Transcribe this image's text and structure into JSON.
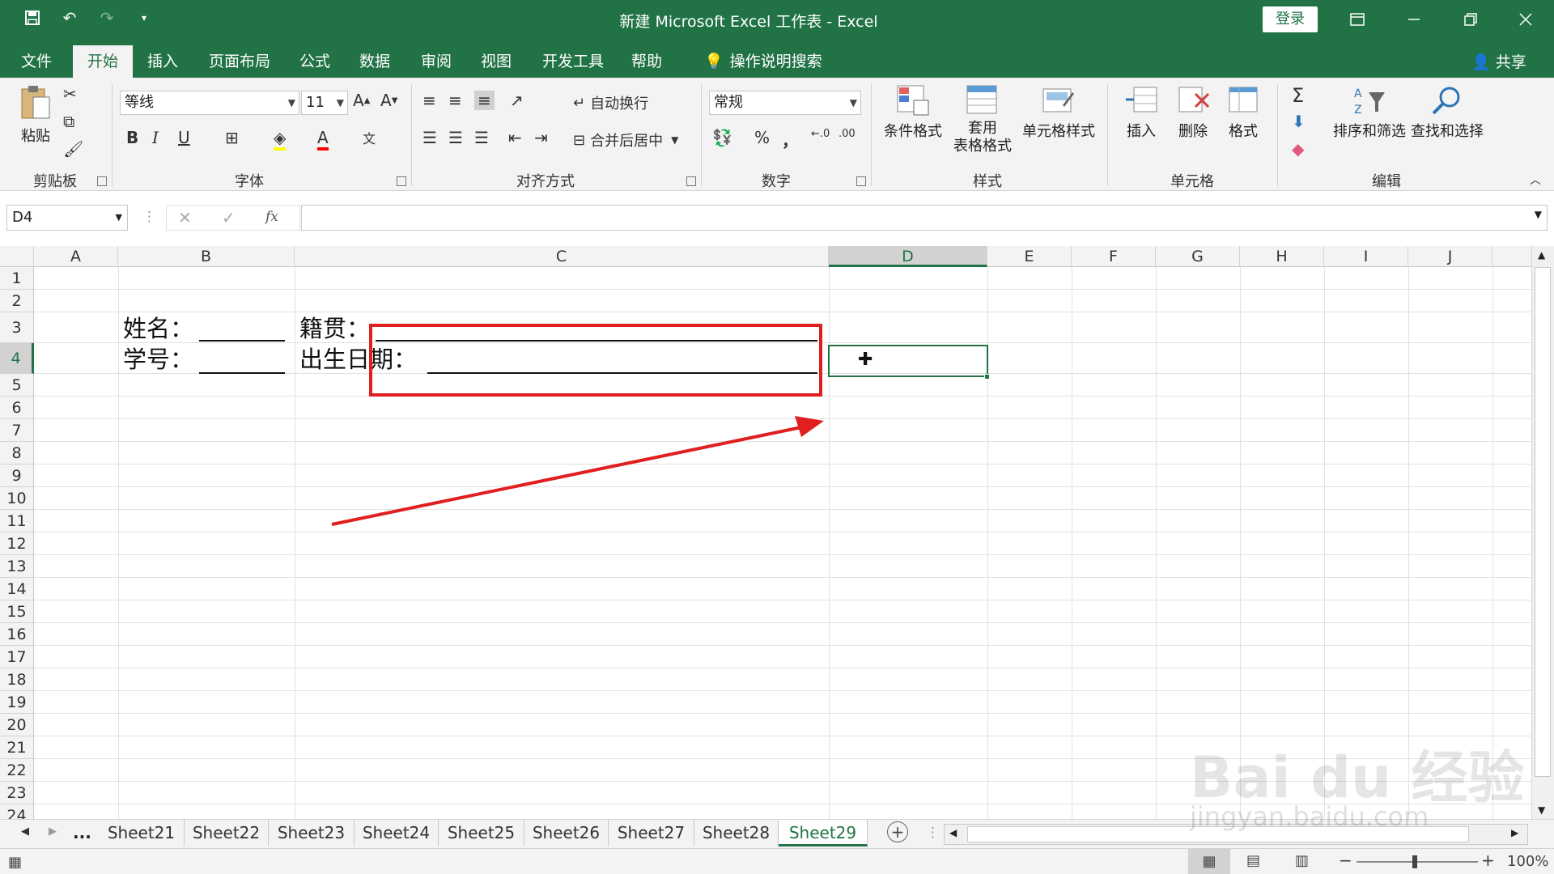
{
  "titlebar": {
    "title": "新建 Microsoft Excel 工作表  -  Excel",
    "signin": "登录"
  },
  "tabs": [
    {
      "label": "文件"
    },
    {
      "label": "开始"
    },
    {
      "label": "插入"
    },
    {
      "label": "页面布局"
    },
    {
      "label": "公式"
    },
    {
      "label": "数据"
    },
    {
      "label": "审阅"
    },
    {
      "label": "视图"
    },
    {
      "label": "开发工具"
    },
    {
      "label": "帮助"
    },
    {
      "label": "操作说明搜索"
    }
  ],
  "share": "共享",
  "ribbon": {
    "clipboard": {
      "label": "剪贴板",
      "paste": "粘贴"
    },
    "font": {
      "label": "字体",
      "name": "等线",
      "size": "11",
      "bold": "B",
      "italic": "I",
      "underline": "U"
    },
    "alignment": {
      "label": "对齐方式",
      "wrap": "自动换行",
      "merge": "合并后居中"
    },
    "number": {
      "label": "数字",
      "format": "常规",
      "percent": "%",
      "comma": "，"
    },
    "styles": {
      "label": "样式",
      "conditional": "条件格式",
      "table_line1": "套用",
      "table_line2": "表格格式",
      "cell_styles": "单元格样式"
    },
    "cells": {
      "label": "单元格",
      "insert": "插入",
      "delete": "删除",
      "format": "格式"
    },
    "editing": {
      "label": "编辑",
      "sort": "排序和筛选",
      "find": "查找和选择"
    }
  },
  "formula_bar": {
    "name_box": "D4",
    "fx": "fx",
    "value": ""
  },
  "columns": [
    "A",
    "B",
    "C",
    "D",
    "E",
    "F",
    "G",
    "H",
    "I",
    "J"
  ],
  "selected_column": "D",
  "rows": [
    "1",
    "2",
    "3",
    "4",
    "5",
    "6",
    "7",
    "8",
    "9",
    "10",
    "11",
    "12",
    "13",
    "14",
    "15",
    "16",
    "17",
    "18",
    "19",
    "20",
    "21",
    "22",
    "23",
    "24"
  ],
  "selected_row": "4",
  "cells": {
    "b3": "姓名：",
    "c3": "籍贯：",
    "b4": "学号：",
    "c4": "出生日期："
  },
  "sheets": {
    "ellipsis": "...",
    "names": [
      "Sheet21",
      "Sheet22",
      "Sheet23",
      "Sheet24",
      "Sheet25",
      "Sheet26",
      "Sheet27",
      "Sheet28",
      "Sheet29"
    ],
    "active": "Sheet29"
  },
  "status": {
    "zoom": "100%"
  },
  "watermark": {
    "text": "Bai du 经验",
    "url": "jingyan.baidu.com"
  },
  "colors": {
    "brand": "#217346",
    "annotation": "#e02020"
  }
}
